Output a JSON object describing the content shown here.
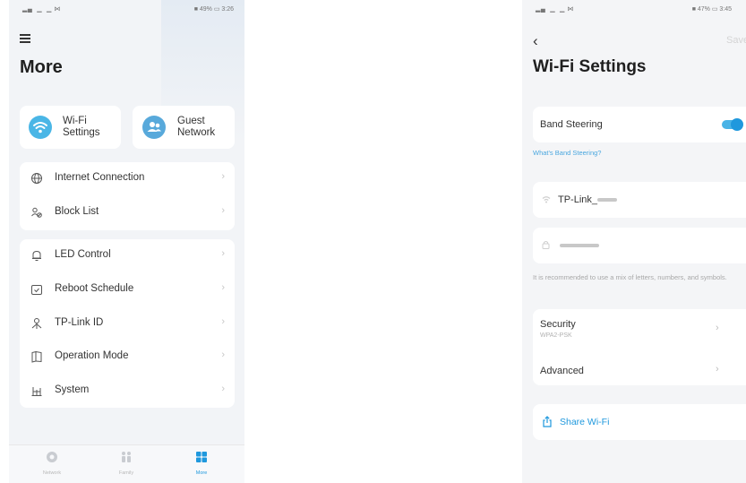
{
  "left_screen": {
    "status": {
      "left": "▂▄  ▁  ▁ ⋈",
      "right": "■ 49% ▭ 3:26"
    },
    "title": "More",
    "quick_actions": [
      {
        "icon": "wifi-icon",
        "label_line1": "Wi-Fi",
        "label_line2": "Settings"
      },
      {
        "icon": "guest-icon",
        "label_line1": "Guest",
        "label_line2": "Network"
      }
    ],
    "group1": [
      {
        "icon": "globe-icon",
        "label": "Internet Connection"
      },
      {
        "icon": "block-list-icon",
        "label": "Block List"
      }
    ],
    "group2": [
      {
        "icon": "bell-icon",
        "label": "LED Control"
      },
      {
        "icon": "calendar-icon",
        "label": "Reboot Schedule"
      },
      {
        "icon": "tp-link-id-icon",
        "label": "TP-Link ID"
      },
      {
        "icon": "book-icon",
        "label": "Operation Mode"
      },
      {
        "icon": "system-icon",
        "label": "System"
      }
    ],
    "tabs": [
      {
        "icon": "network-icon",
        "label": "Network",
        "active": false
      },
      {
        "icon": "family-icon",
        "label": "Family",
        "active": false
      },
      {
        "icon": "more-grid-icon",
        "label": "More",
        "active": true
      }
    ]
  },
  "right_screen": {
    "status": {
      "left": "▂▄  ▁  ▁ ⋈",
      "right": "■ 47% ▭ 3:45"
    },
    "save_label": "Save",
    "title": "Wi-Fi Settings",
    "band_steering_label": "Band Steering",
    "band_steering_on": true,
    "band_steering_link": "What's Band Steering?",
    "ssid_prefix": "TP-Link_",
    "password_hint": "It is recommended to use a mix of letters, numbers, and symbols.",
    "security_label": "Security",
    "security_value": "WPA2-PSK",
    "advanced_label": "Advanced",
    "share_label": "Share Wi-Fi",
    "accent_color": "#1f98dd"
  }
}
